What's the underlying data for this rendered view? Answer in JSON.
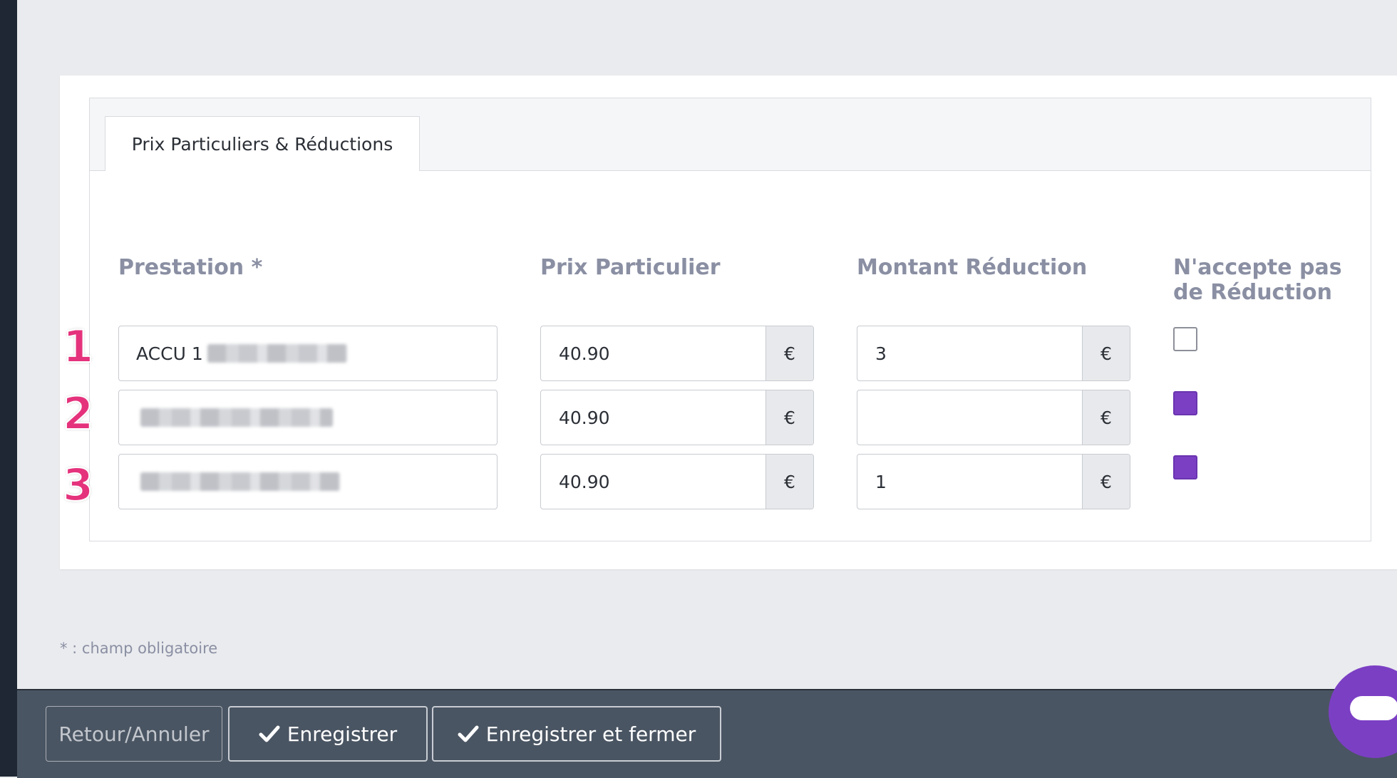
{
  "tab": {
    "label": "Prix Particuliers & Réductions"
  },
  "columns": {
    "prestation": "Prestation *",
    "prix": "Prix Particulier",
    "reduction": "Montant Réduction",
    "no_reduction_line1": "N'accepte pas",
    "no_reduction_line2": "de Réduction"
  },
  "rows": [
    {
      "index": "1",
      "prestation": "ACCU 1",
      "prix": "40.90",
      "prix_unit": "€",
      "reduction": "3",
      "reduction_unit": "€",
      "no_reduction": false
    },
    {
      "index": "2",
      "prestation": "",
      "prix": "40.90",
      "prix_unit": "€",
      "reduction": "",
      "reduction_unit": "€",
      "no_reduction": true
    },
    {
      "index": "3",
      "prestation": "",
      "prix": "40.90",
      "prix_unit": "€",
      "reduction": "1",
      "reduction_unit": "€",
      "no_reduction": true
    }
  ],
  "footnote": "* : champ obligatoire",
  "buttons": {
    "cancel": "Retour/Annuler",
    "save": "Enregistrer",
    "save_close": "Enregistrer et fermer"
  },
  "icons": {
    "save": "check-icon",
    "chat": "chat-bubble-icon"
  },
  "colors": {
    "accent": "#7b3fc4",
    "annotation": "#e5327c",
    "footer": "#4a5563"
  }
}
